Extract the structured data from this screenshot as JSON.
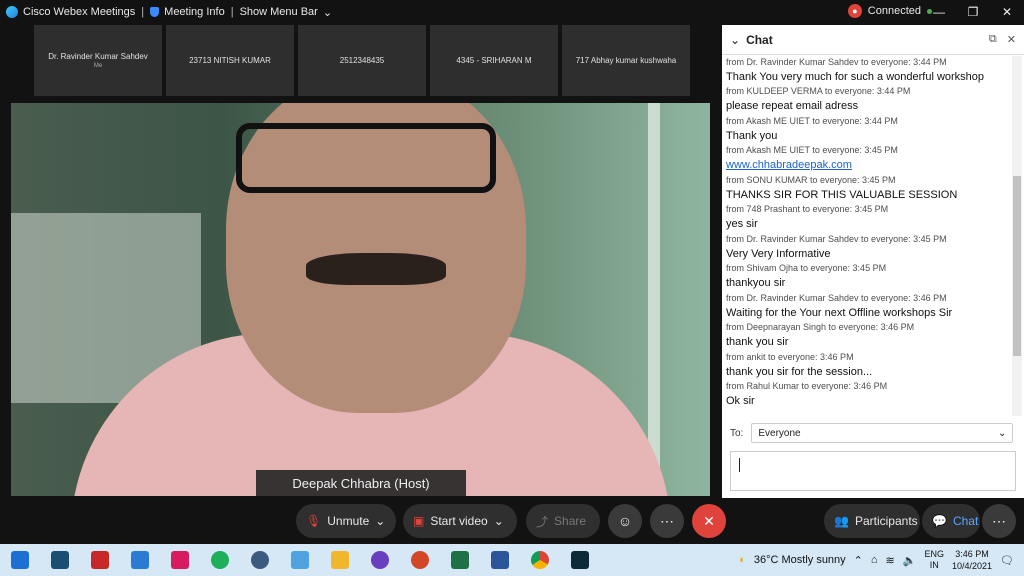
{
  "titlebar": {
    "app_name": "Cisco Webex Meetings",
    "meeting_info": "Meeting Info",
    "menu_toggle": "Show Menu Bar",
    "connection_status": "Connected"
  },
  "participants_strip": [
    {
      "name": "Dr. Ravinder Kumar Sahdev",
      "sub": "Me"
    },
    {
      "name": "23713 NITISH KUMAR",
      "sub": ""
    },
    {
      "name": "2512348435",
      "sub": ""
    },
    {
      "name": "4345 - SRIHARAN M",
      "sub": ""
    },
    {
      "name": "717 Abhay kumar kushwaha",
      "sub": ""
    }
  ],
  "video": {
    "host_label": "Deepak Chhabra (Host)"
  },
  "chat": {
    "title": "Chat",
    "messages": [
      {
        "text": "Thank You very much for such a wonderful workshop",
        "from": "from KULDEEP VERMA to everyone:    3:44 PM"
      },
      {
        "text": "please repeat email adress",
        "from": "from Akash ME UIET to everyone:    3:44 PM"
      },
      {
        "text": "Thank you",
        "from": "from Akash ME UIET to everyone:    3:45 PM"
      },
      {
        "text": "www.chhabradeepak.com",
        "from": "from SONU KUMAR to everyone:    3:45 PM",
        "link": true
      },
      {
        "text": "THANKS SIR FOR THIS VALUABLE SESSION",
        "from": "from 748 Prashant to everyone:    3:45 PM"
      },
      {
        "text": "yes sir",
        "from": "from Dr. Ravinder Kumar Sahdev to everyone:    3:45 PM"
      },
      {
        "text": "Very Very Informative",
        "from": "from Shivam Ojha to everyone:    3:45 PM"
      },
      {
        "text": "thankyou sir",
        "from": "from Dr. Ravinder Kumar Sahdev to everyone:    3:46 PM"
      },
      {
        "text": "Waiting for the Your next Offline workshops Sir",
        "from": "from Deepnarayan Singh to everyone:    3:46 PM"
      },
      {
        "text": "thank you sir",
        "from": "from ankit to everyone:    3:46 PM"
      },
      {
        "text": "thank you sir for the session...",
        "from": "from Rahul Kumar  to everyone:    3:46 PM"
      },
      {
        "text": "Ok sir",
        "from": ""
      }
    ],
    "to_label": "To:",
    "to_value": "Everyone"
  },
  "controls": {
    "unmute": "Unmute",
    "start_video": "Start video",
    "share": "Share",
    "participants": "Participants",
    "chat": "Chat"
  },
  "taskbar": {
    "weather": "36°C  Mostly sunny",
    "lang_1": "ENG",
    "lang_2": "IN",
    "time": "3:46 PM",
    "date": "10/4/2021"
  },
  "colors": {
    "end_call": "#e0433b",
    "link": "#1a63c9",
    "chat_active": "#5aa7ff"
  }
}
